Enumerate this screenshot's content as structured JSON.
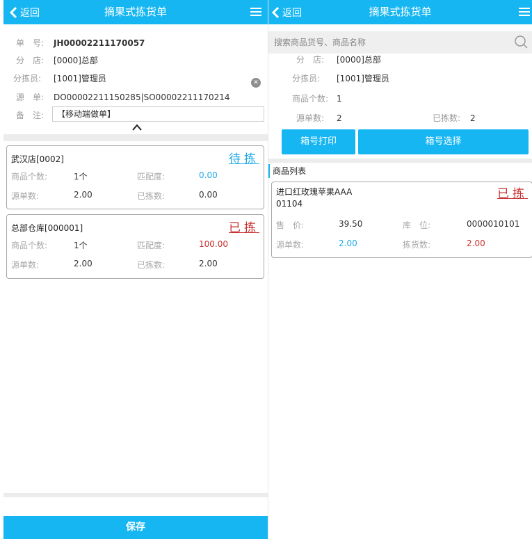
{
  "left": {
    "header": {
      "back_label": "返回",
      "title": "摘果式拣货单"
    },
    "fields": {
      "order_no_label": "单　号:",
      "order_no": "JH00002211170057",
      "branch_label": "分　店:",
      "branch": "[0000]总部",
      "picker_label": "分拣员:",
      "picker": "[1001]管理员",
      "source_label": "源　单:",
      "source": "DO00002211150285|SO00002211170214",
      "note_label": "备　注:",
      "note": "【移动端做单】"
    },
    "cards": [
      {
        "name": "武汉店[0002]",
        "status": "待拣",
        "qty_label": "商品个数:",
        "qty": "1个",
        "match_label": "匹配度:",
        "match": "0.00",
        "src_label": "源单数:",
        "src": "2.00",
        "picked_label": "已拣数:",
        "picked": "0.00"
      },
      {
        "name": "总部仓库[000001]",
        "status": "已拣",
        "qty_label": "商品个数:",
        "qty": "1个",
        "match_label": "匹配度:",
        "match": "100.00",
        "src_label": "源单数:",
        "src": "2.00",
        "picked_label": "已拣数:",
        "picked": "2.00"
      }
    ],
    "save_label": "保存"
  },
  "right": {
    "header": {
      "back_label": "返回",
      "title": "摘果式拣货单"
    },
    "search_placeholder": "搜索商品货号、商品名称",
    "fields": {
      "branch_label": "分　店:",
      "branch": "[0000]总部",
      "picker_label": "分拣员:",
      "picker": "[1001]管理员",
      "count_label": "商品个数:",
      "count": "1",
      "source_label": "源单数:",
      "source": "2",
      "picked_label": "已拣数:",
      "picked": "2"
    },
    "print_label": "箱号打印",
    "select_label": "箱号选择",
    "list_title": "商品列表",
    "product": {
      "name": "进口红玫瑰苹果AAA",
      "code": "01104",
      "status": "已拣",
      "price_label": "售　价:",
      "price": "39.50",
      "loc_label": "库　位:",
      "loc": "0000010101",
      "src_label": "源单数:",
      "src": "2.00",
      "picked_label": "拣货数:",
      "picked": "2.00"
    }
  },
  "colors": {
    "accent": "#16b6f2",
    "blue_value": "#1ea8e6",
    "red_value": "#c8302f"
  }
}
